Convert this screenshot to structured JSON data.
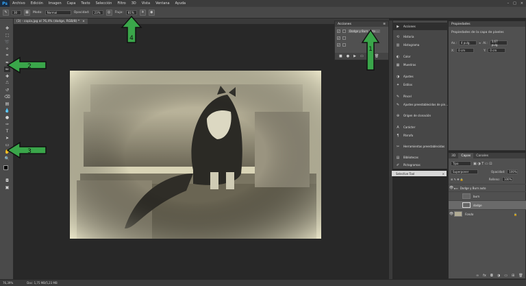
{
  "app": {
    "logo": "Ps"
  },
  "menu": [
    "Archivo",
    "Edición",
    "Imagen",
    "Capa",
    "Texto",
    "Selección",
    "Filtro",
    "3D",
    "Vista",
    "Ventana",
    "Ayuda"
  ],
  "options": {
    "brush_size": "30",
    "mode_label": "Modo:",
    "mode_value": "Normal",
    "opacity_label": "Opacidad:",
    "opacity_value": "23%",
    "flow_label": "Flujo:",
    "flow_value": "81%"
  },
  "document_tab": "(3) - copia.jpg al 76,4% (dodge, RGB/8) *",
  "actions_panel": {
    "title": "Acciones",
    "rows": [
      "Dodge y Burn Auto ...",
      "",
      ""
    ]
  },
  "panel_list": [
    {
      "icon": "▶",
      "label": "Acciones"
    },
    {
      "icon": "⟲",
      "label": "Historia"
    },
    {
      "icon": "▥",
      "label": "Histograma"
    },
    {
      "icon": "◐",
      "label": "Color"
    },
    {
      "icon": "▦",
      "label": "Muestras"
    },
    {
      "icon": "◑",
      "label": "Ajustes"
    },
    {
      "icon": "✦",
      "label": "Estilos"
    },
    {
      "icon": "✎",
      "label": "Pincel"
    },
    {
      "icon": "✎",
      "label": "Ajustes preestablecidos de pin..."
    },
    {
      "icon": "⊕",
      "label": "Origen de clonación"
    },
    {
      "icon": "A",
      "label": "Carácter"
    },
    {
      "icon": "¶",
      "label": "Párrafo"
    },
    {
      "icon": "✂",
      "label": "Herramientas preestablecidas"
    },
    {
      "icon": "▤",
      "label": "Bibliotecas"
    },
    {
      "icon": "✐",
      "label": "Pictogramas"
    }
  ],
  "properties": {
    "title": "Propiedades",
    "subtitle": "Propiedades de la capa de píxeles",
    "an_label": "An.:",
    "an_value": "4 pulg.",
    "al_label": "Al.:",
    "al_value": "3,67 pulg.",
    "x_label": "X:",
    "x_value": "0 cm",
    "y_label": "Y:",
    "y_value": "0 cm"
  },
  "selective_tool": "Selective Tool",
  "layers": {
    "tabs": [
      "3D",
      "Capas",
      "Canales"
    ],
    "filter": "Tipo",
    "blend_mode": "Superponer",
    "opacity_label": "Opacidad:",
    "opacity_value": "100%",
    "fill_label": "Relleno:",
    "fill_value": "100%",
    "rows": [
      "Dodge y Burn auto",
      "burn",
      "dodge",
      "Fondo"
    ]
  },
  "status": {
    "zoom": "76,39%",
    "doc": "Doc: 1,75 MB/5,23 MB"
  },
  "annotations": [
    "1",
    "2",
    "3",
    "4"
  ],
  "colors": {
    "arrow_green": "#3aa64a",
    "arrow_outline": "#111111",
    "panel_bg": "#505050",
    "photo_tone": "#e6e2c4"
  }
}
